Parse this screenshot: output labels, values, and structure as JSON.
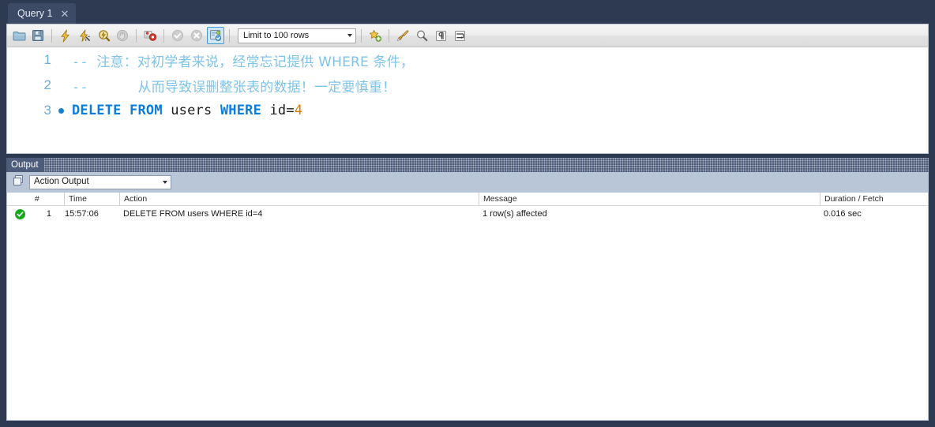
{
  "window": {
    "tab": {
      "label": "Query 1",
      "close_icon": "close-icon"
    }
  },
  "toolbar": {
    "buttons": [
      {
        "name": "open-sql-script-icon",
        "title": "Open a SQL script file in a new tab"
      },
      {
        "name": "save-script-icon",
        "title": "Save the script to a file"
      },
      {
        "name": "execute-statement-icon",
        "title": "Execute the selected portion of the script"
      },
      {
        "name": "execute-current-statement-icon",
        "title": "Execute the statement under the keyboard cursor"
      },
      {
        "name": "explain-statement-icon",
        "title": "Execute the EXPLAIN command on the statement under the cursor"
      },
      {
        "name": "stop-execution-icon",
        "title": "Stop the query being executed"
      },
      {
        "name": "toggle-stop-on-error-icon",
        "title": "Toggle whether execution should stop or continue if errors occur"
      },
      {
        "name": "commit-transaction-icon",
        "title": "Commit the current transaction"
      },
      {
        "name": "rollback-transaction-icon",
        "title": "Rollback the current transaction"
      },
      {
        "name": "toggle-autocommit-icon",
        "title": "Toggle auto-commit mode"
      }
    ],
    "limit_select": {
      "label": "Limit to 100 rows",
      "arrow_icon": "chevron-down-icon"
    },
    "right_buttons": [
      {
        "name": "save-snippet-icon",
        "title": "Save current statement or selection to the snippet list"
      },
      {
        "name": "beautify-sql-icon",
        "title": "Beautify/reformat the SQL script"
      },
      {
        "name": "find-icon",
        "title": "Show the Find panel for the editor"
      },
      {
        "name": "toggle-invisible-chars-icon",
        "title": "Toggle invisible characters"
      },
      {
        "name": "toggle-wrapping-icon",
        "title": "Toggle wrapping of long lines"
      }
    ]
  },
  "editor": {
    "lines": [
      {
        "number": "1",
        "marker": false,
        "tokens": [
          {
            "type": "comment",
            "text": "-- "
          },
          {
            "type": "comment-cjk",
            "text": "注意：对初学者来说，经常忘记提供 WHERE 条件，"
          }
        ]
      },
      {
        "number": "2",
        "marker": false,
        "tokens": [
          {
            "type": "comment",
            "text": "--      "
          },
          {
            "type": "comment-cjk",
            "text": "从而导致误删整张表的数据！一定要慎重！"
          }
        ]
      },
      {
        "number": "3",
        "marker": true,
        "tokens": [
          {
            "type": "keyword",
            "text": "DELETE FROM "
          },
          {
            "type": "identifier",
            "text": "users "
          },
          {
            "type": "keyword",
            "text": "WHERE "
          },
          {
            "type": "identifier",
            "text": "id"
          },
          {
            "type": "operator",
            "text": "="
          },
          {
            "type": "number",
            "text": "4"
          }
        ]
      }
    ]
  },
  "output": {
    "panel_title": "Output",
    "view_select": {
      "value": "Action Output",
      "arrow_icon": "chevron-down-icon"
    },
    "columns": [
      {
        "key": "num",
        "label": "#"
      },
      {
        "key": "time",
        "label": "Time"
      },
      {
        "key": "action",
        "label": "Action"
      },
      {
        "key": "message",
        "label": "Message"
      },
      {
        "key": "duration",
        "label": "Duration / Fetch"
      }
    ],
    "rows": [
      {
        "status": "success",
        "status_icon": "check-circle-icon",
        "num": "1",
        "time": "15:57:06",
        "action": "DELETE FROM users WHERE id=4",
        "message": "1 row(s) affected",
        "duration": "0.016 sec"
      }
    ]
  },
  "colors": {
    "window_chrome": "#2d3a52",
    "output_header": "#4d5c7a",
    "output_toolbar": "#b9c6d8",
    "keyword": "#0a7ddb",
    "comment": "#7fc3e8",
    "number_literal": "#e07b00",
    "success": "#18a81b",
    "line_number": "#6aaed6"
  }
}
